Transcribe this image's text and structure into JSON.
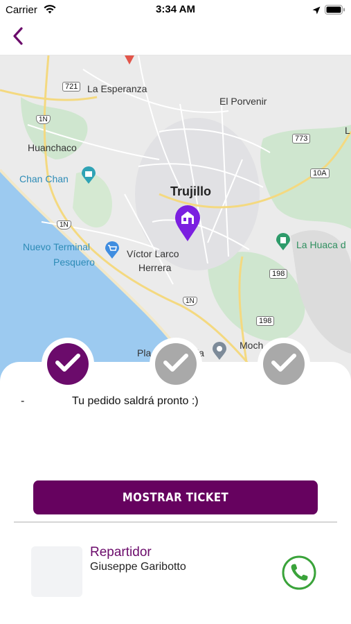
{
  "status_bar": {
    "carrier": "Carrier",
    "time": "3:34 AM"
  },
  "nav": {
    "back_icon": "chevron-left-icon"
  },
  "map": {
    "labels": {
      "la_esperanza": "La Esperanza",
      "el_porvenir": "El Porvenir",
      "huanchaco": "Huanchaco",
      "chan_chan": "Chan Chan",
      "trujillo": "Trujillo",
      "nuevo_terminal": "Nuevo Terminal",
      "pesquero": "Pesquero",
      "victor_larco": "Víctor Larco",
      "herrera": "Herrera",
      "la_huaca": "La Huaca d",
      "plaza": "Pla",
      "plaza_end": "ia",
      "moche": "Moch",
      "edge_l": "L"
    },
    "shields": {
      "r721": "721",
      "r1n_a": "1N",
      "r1n_b": "1N",
      "r1n_c": "1N",
      "r773": "773",
      "r10a": "10A",
      "r198_a": "198",
      "r198_b": "198"
    }
  },
  "progress_steps": [
    {
      "state": "active"
    },
    {
      "state": "inactive"
    },
    {
      "state": "inactive"
    }
  ],
  "order_status": {
    "dash": "-",
    "message": "Tu pedido saldrá pronto :)"
  },
  "ticket_button": {
    "label": "MOSTRAR TICKET"
  },
  "driver": {
    "role": "Repartidor",
    "name": "Giuseppe Garibotto",
    "call_icon": "phone-icon"
  },
  "colors": {
    "accent": "#6b0b6b",
    "button": "#66025f",
    "call": "#3aa33a",
    "step_inactive": "#a9a9a9"
  }
}
